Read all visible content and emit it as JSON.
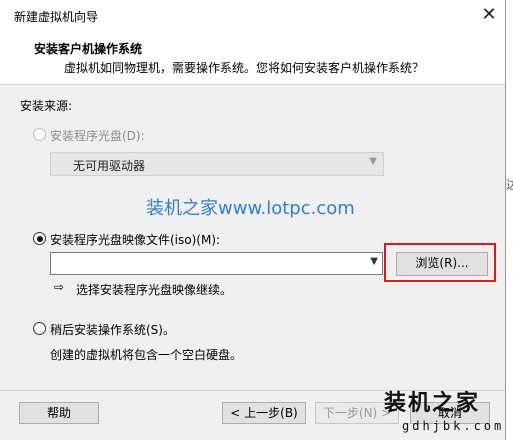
{
  "window": {
    "title": "新建虚拟机向导"
  },
  "header": {
    "title": "安装客户机操作系统",
    "subtitle": "虚拟机如同物理机，需要操作系统。您将如何安装客户机操作系统？"
  },
  "source": {
    "label": "安装来源:",
    "disc_option": "安装程序光盘(D):",
    "disc_dropdown_value": "无可用驱动器",
    "iso_option": "安装程序光盘映像文件(iso)(M):",
    "iso_path_value": "",
    "browse_label": "浏览(R)...",
    "hint_arrow": "⇨",
    "hint_text": "选择安装程序光盘映像继续。",
    "later_option": "稍后安装操作系统(S)。",
    "later_desc": "创建的虚拟机将包含一个空白硬盘。"
  },
  "watermark": {
    "text": "装机之家www.lotpc.com"
  },
  "footer": {
    "help_label": "帮助",
    "back_label": "< 上一步(B)",
    "next_label": "下一步(N) >",
    "cancel_label": "取消"
  },
  "stamp": {
    "big": "装机之家",
    "small": "gdhjbk.com"
  },
  "edge": {
    "glyph": "达"
  },
  "colors": {
    "highlight_box": "#e01a1a",
    "watermark": "#2f7fd6"
  },
  "selected_option": "iso"
}
